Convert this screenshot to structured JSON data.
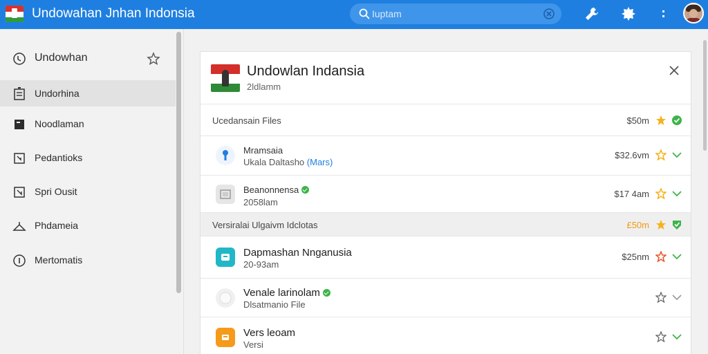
{
  "app": {
    "title": "Undowahan Jnhan Indonsia",
    "search_placeholder": "Iuptam",
    "colors": {
      "topbar": "#1f7fe0",
      "star": "#f5b21b",
      "check": "#3cb44a",
      "orange": "#f09a12"
    }
  },
  "toolbar": {
    "icons": [
      "search-icon",
      "clear-icon",
      "wrench-icon",
      "puzzle-icon",
      "more-icon"
    ]
  },
  "sidebar": {
    "items": [
      {
        "label": "Undowhan",
        "icon": "search-icon",
        "pinned": true
      },
      {
        "label": "Undorhina",
        "icon": "list-icon",
        "active": true
      },
      {
        "label": "Noodlaman",
        "icon": "square-icon"
      },
      {
        "label": "Pedantioks",
        "icon": "corner-icon"
      },
      {
        "label": "Spri Ousit",
        "icon": "corner-icon"
      },
      {
        "label": "Phdameia",
        "icon": "hanger-icon"
      },
      {
        "label": "Mertomatis",
        "icon": "info-icon"
      }
    ]
  },
  "panel": {
    "title": "Undowlan Indansia",
    "subtitle": "2ldlamm",
    "sections": [
      {
        "label": "Ucedansain Files",
        "price": "$50m"
      },
      {
        "label": "Versiralai Ulgaivm Idclotas",
        "price": "£50m"
      }
    ],
    "rows": [
      {
        "title": "Mramsaia",
        "sub": "Ukala Daltasho",
        "sub_link": "(Mars)",
        "price": "$32.6vm",
        "icon": "key-icon"
      },
      {
        "title": "Beanonnensa",
        "sub": "2058lam",
        "price": "$17 4am",
        "icon": "photo-icon",
        "verified": true
      },
      {
        "title": "Dapmashan Nnganusia",
        "sub": "20-93am",
        "price": "$25nm",
        "icon": "chat-icon"
      },
      {
        "title": "Venale larinolam",
        "sub": "Dlsatmanio File",
        "price": "",
        "icon": "disc-icon",
        "verified": true
      },
      {
        "title": "Vers leoam",
        "sub": "Versi",
        "price": "",
        "icon": "folder-icon"
      }
    ]
  }
}
